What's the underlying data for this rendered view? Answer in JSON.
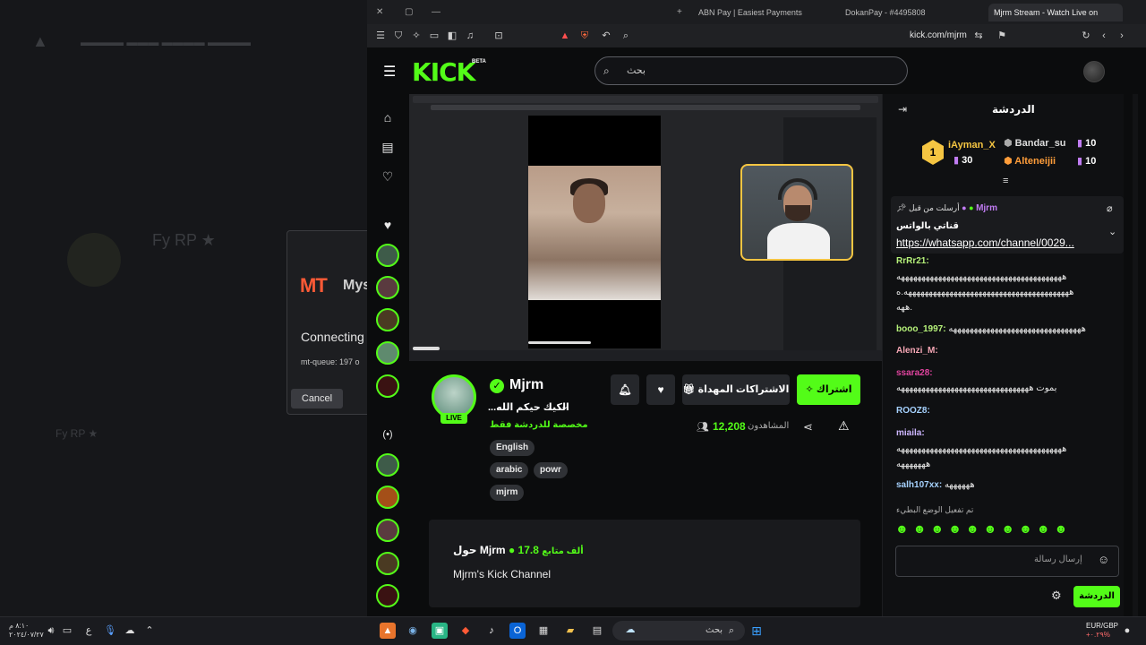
{
  "background_app": {
    "items": [
      "Fy RP ★",
      "Fy RP ★",
      "Cancel"
    ],
    "dialog_brand": "MT",
    "dialog_brand_text": "Mys",
    "dialog_status": "Connecting",
    "dialog_queue": "mt-queue: 197 o",
    "dialog_cancel": "Cancel"
  },
  "browser": {
    "tabs": [
      {
        "label": "ABN Pay | Easiest Payments"
      },
      {
        "label": "DokanPay - #4495808"
      },
      {
        "label": "Mjrm Stream - Watch Live on"
      }
    ],
    "url": "kick.com/mjrm"
  },
  "header": {
    "logo": "KICK",
    "logo_badge": "BETA",
    "search_placeholder": "بحث"
  },
  "streamer": {
    "name": "Mjrm",
    "live_label": "LIVE",
    "title": "...الكيك حيكم الله",
    "category": "مخصصة للدردشة فقط",
    "tags": [
      "English",
      "arabic",
      "powr",
      "mjrm"
    ],
    "subscribe_label": "اشتراك",
    "gift_label": "الاشتراكات المهداة",
    "viewers": "12,208",
    "viewers_label": "المشاهدون"
  },
  "about": {
    "title": "حول Mjrm",
    "followers": "17.8",
    "followers_label": "ألف متابع",
    "description": "Mjrm's Kick Channel"
  },
  "chat": {
    "title": "الدردشة",
    "leaders": [
      {
        "rank": "1",
        "name": "iAyman_X",
        "count": "30"
      },
      {
        "name": "Bandar_su",
        "count": "10"
      },
      {
        "name": "Alteneijii",
        "count": "10"
      }
    ],
    "pinned": {
      "by_label": "أرسلت من قبل",
      "author": "Mjrm",
      "text": "قناتي بالواتس",
      "link": "https://whatsapp.com/channel/0029..."
    },
    "messages": [
      {
        "user": "RrRr21:",
        "text": "",
        "color": "#b6f27a"
      },
      {
        "user": "",
        "text": "ههههههههههههههههههههههههههههههههههههههههه",
        "color": "#ffffff"
      },
      {
        "user": "",
        "text": "ههههههههههههههههههههههههههههههههههههههههه.ه",
        "color": "#ffffff"
      },
      {
        "user": "",
        "text": "ههه.",
        "color": "#ffffff"
      },
      {
        "user": "booo_1997:",
        "text": "ههههههههههههههههههههههههههههههههه",
        "color": "#b6f27a"
      },
      {
        "user": "Alenzi_M:",
        "text": "",
        "color": "#f6a7b5"
      },
      {
        "user": "ssara28:",
        "text": "",
        "color": "#e0449f"
      },
      {
        "user": "",
        "text": "بموت ههههههههههههههههههههههههههههههههه",
        "color": "#ffffff"
      },
      {
        "user": "ROOZ8:",
        "text": "",
        "color": "#a6d2ff"
      },
      {
        "user": "miaila:",
        "text": "",
        "color": "#cdb6ff"
      },
      {
        "user": "",
        "text": "ههههههههههههههههههههههههههههههههههههههههه",
        "color": "#ffffff"
      },
      {
        "user": "",
        "text": "هههههههه",
        "color": "#ffffff"
      },
      {
        "user": "salh107xx:",
        "text": "ههههههه",
        "color": "#a6d2ff"
      }
    ],
    "slow_mode": "تم تفعيل الوضع البطيء",
    "input_placeholder": "إرسال رسالة",
    "send_label": "الدردشة"
  },
  "taskbar": {
    "search": "بحث",
    "clock_time": "٨:١٠ م",
    "clock_date": "٢٠٢٤/٠٧/٢٧",
    "currency": "EUR/GBP",
    "currency_change": "+٠.٢٩%"
  },
  "colors": {
    "accent": "#53fc18"
  }
}
